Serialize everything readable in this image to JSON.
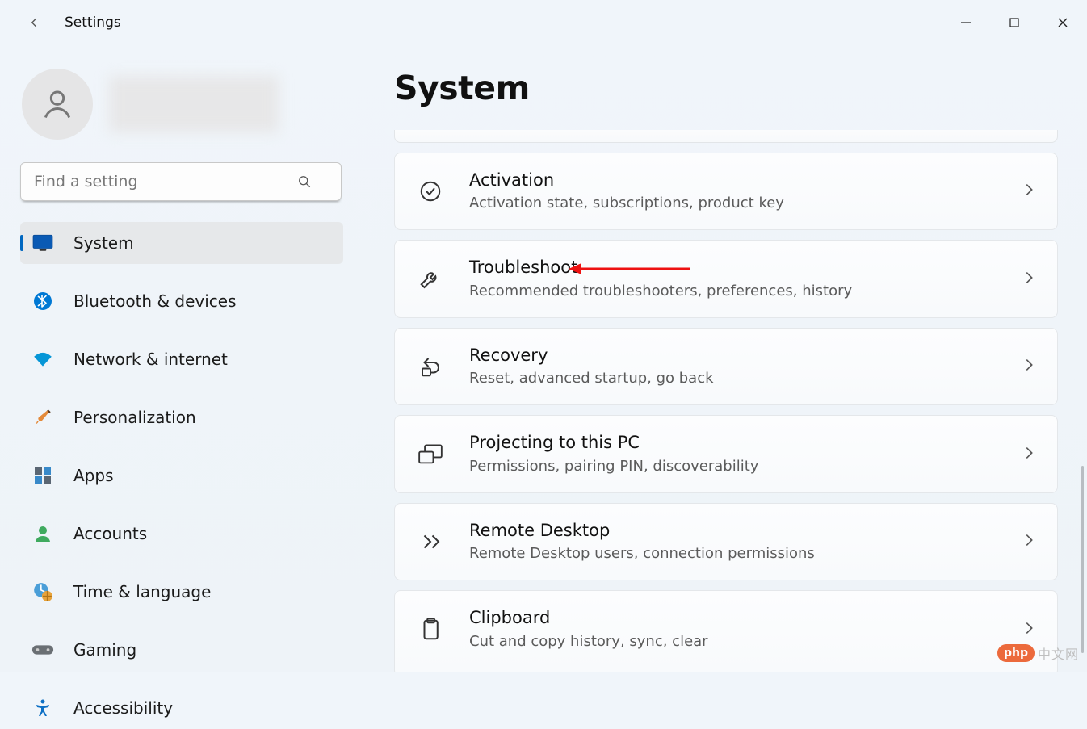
{
  "app": {
    "title": "Settings"
  },
  "search": {
    "placeholder": "Find a setting"
  },
  "sidebar": {
    "items": [
      {
        "label": "System",
        "icon": "display-icon",
        "active": true
      },
      {
        "label": "Bluetooth & devices",
        "icon": "bluetooth-icon"
      },
      {
        "label": "Network & internet",
        "icon": "wifi-icon"
      },
      {
        "label": "Personalization",
        "icon": "brush-icon"
      },
      {
        "label": "Apps",
        "icon": "apps-icon"
      },
      {
        "label": "Accounts",
        "icon": "person-icon"
      },
      {
        "label": "Time & language",
        "icon": "clock-globe-icon"
      },
      {
        "label": "Gaming",
        "icon": "gamepad-icon"
      },
      {
        "label": "Accessibility",
        "icon": "accessibility-icon"
      }
    ]
  },
  "page": {
    "title": "System",
    "cards": [
      {
        "title": "Activation",
        "sub": "Activation state, subscriptions, product key",
        "icon": "check-circle-icon"
      },
      {
        "title": "Troubleshoot",
        "sub": "Recommended troubleshooters, preferences, history",
        "icon": "wrench-icon"
      },
      {
        "title": "Recovery",
        "sub": "Reset, advanced startup, go back",
        "icon": "recovery-icon"
      },
      {
        "title": "Projecting to this PC",
        "sub": "Permissions, pairing PIN, discoverability",
        "icon": "projecting-icon"
      },
      {
        "title": "Remote Desktop",
        "sub": "Remote Desktop users, connection permissions",
        "icon": "remote-desktop-icon"
      },
      {
        "title": "Clipboard",
        "sub": "Cut and copy history, sync, clear",
        "icon": "clipboard-icon"
      }
    ]
  },
  "watermark": {
    "bubble": "php",
    "text": "中文网"
  }
}
